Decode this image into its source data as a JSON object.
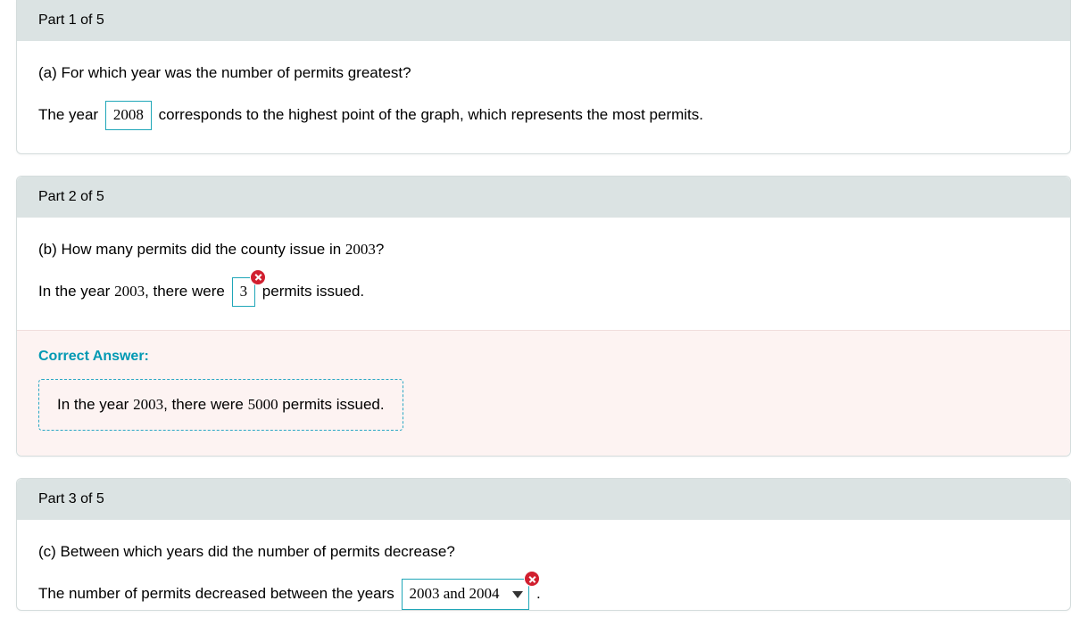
{
  "part1": {
    "header": "Part 1 of 5",
    "question": "(a)  For which year was the number of permits greatest?",
    "t1": "The year",
    "answer": "2008",
    "t2": "corresponds to the highest point of the graph, which represents the most permits."
  },
  "part2": {
    "header": "Part 2 of 5",
    "q1": "(b)  How many permits did the county issue in ",
    "q_year": "2003",
    "q2": "?",
    "t1": "In the year ",
    "year": "2003",
    "t2": ", there were",
    "answer": "3",
    "t3": "permits issued.",
    "correct_label": "Correct Answer:",
    "c1": "In the year ",
    "c_year": "2003",
    "c2": ", there were ",
    "c_val": "5000",
    "c3": " permits issued."
  },
  "part3": {
    "header": "Part 3 of 5",
    "question": "(c)  Between which years did the number of permits decrease?",
    "t1": "The number of permits decreased between the years",
    "dd": "2003 and 2004",
    "t2": "."
  }
}
